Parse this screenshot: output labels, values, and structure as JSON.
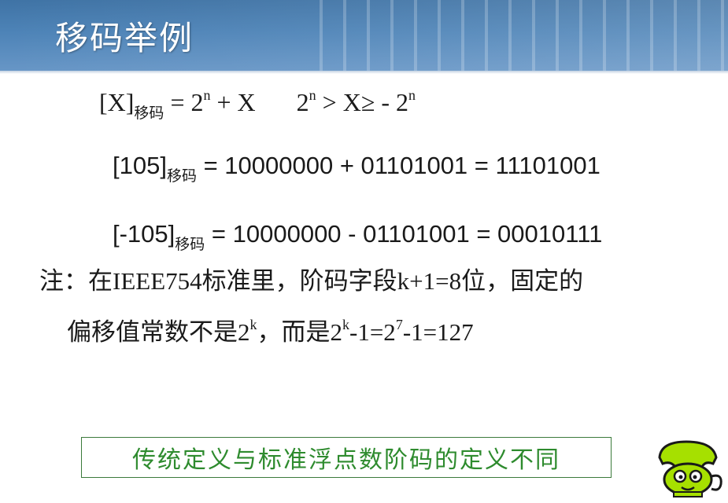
{
  "slide": {
    "title": "移码举例"
  },
  "formula": {
    "lhs": "[X]",
    "lhs_sub": "移码",
    "rhs": " = 2",
    "rhs_exp": "n",
    "rhs_tail": " + X",
    "range_base": "2",
    "range_exp": "n",
    "range_mid": " > X≥ - 2",
    "range_exp2": "n"
  },
  "example1": {
    "lhs": "[105]",
    "lhs_sub": "移码",
    "rhs": " = 10000000 + 01101001 = 11101001"
  },
  "example2": {
    "lhs": "[-105]",
    "lhs_sub": "移码",
    "rhs": " = 10000000 - 01101001 = 00010111"
  },
  "note": {
    "line1_a": "注：在",
    "line1_b": "IEEE754",
    "line1_c": "标准里，阶码字段",
    "line1_d": "k+1=8",
    "line1_e": "位，固定的",
    "line2_a": "偏移值常数不是",
    "line2_b": "2",
    "line2_b_exp": "k",
    "line2_c": "，而是",
    "line2_d": "2",
    "line2_d_exp": "k",
    "line2_e": "-1=2",
    "line2_e_exp": "7",
    "line2_f": "-1=127"
  },
  "callout": {
    "text": "传统定义与标准浮点数阶码的定义不同",
    "color": "#2e8b2e"
  },
  "colors": {
    "header": "#4d83b7",
    "text": "#1a1a1a",
    "mascot": "#a6e000"
  }
}
